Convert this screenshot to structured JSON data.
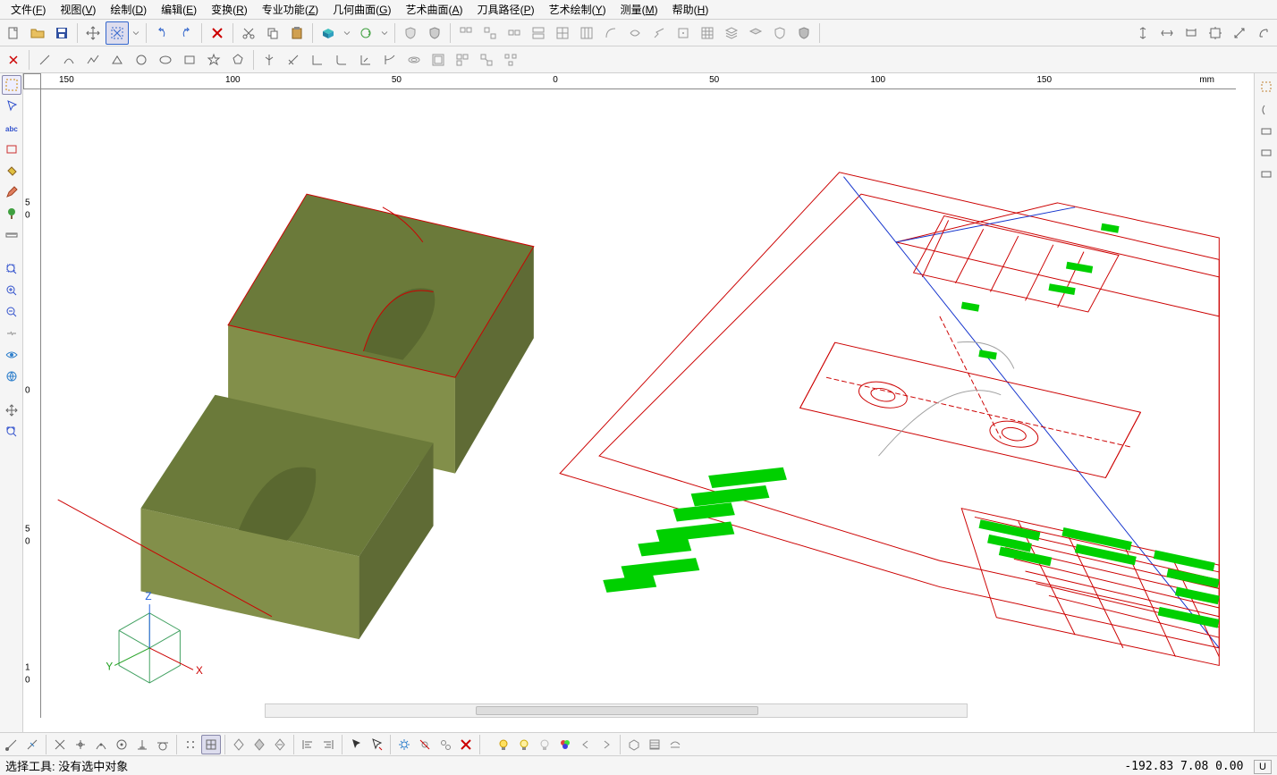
{
  "menu": {
    "items": [
      {
        "label": "文件",
        "key": "F"
      },
      {
        "label": "视图",
        "key": "V"
      },
      {
        "label": "绘制",
        "key": "D"
      },
      {
        "label": "编辑",
        "key": "E"
      },
      {
        "label": "变换",
        "key": "R"
      },
      {
        "label": "专业功能",
        "key": "Z"
      },
      {
        "label": "几何曲面",
        "key": "G"
      },
      {
        "label": "艺术曲面",
        "key": "A"
      },
      {
        "label": "刀具路径",
        "key": "P"
      },
      {
        "label": "艺术绘制",
        "key": "Y"
      },
      {
        "label": "测量",
        "key": "M"
      },
      {
        "label": "帮助",
        "key": "H"
      }
    ]
  },
  "ruler": {
    "unit": "mm",
    "h_labels": [
      "150",
      "100",
      "50",
      "0",
      "50",
      "100",
      "150"
    ],
    "v_labels": [
      "5",
      "0",
      "0",
      "5",
      "0",
      "1",
      "0"
    ]
  },
  "axes": {
    "x": "X",
    "y": "Y",
    "z": "Z"
  },
  "status": {
    "tool_text": "选择工具:  没有选中对象",
    "coords": "-192.83 7.08 0.00",
    "btn": "U"
  },
  "colors": {
    "solid_top": "#6b7a3a",
    "solid_side": "#828f4a",
    "solid_front": "#7a8842",
    "outline_red": "#cc0000",
    "outline_blue": "#1030cc",
    "outline_green": "#00d000",
    "outline_grey": "#a0a0a0"
  }
}
